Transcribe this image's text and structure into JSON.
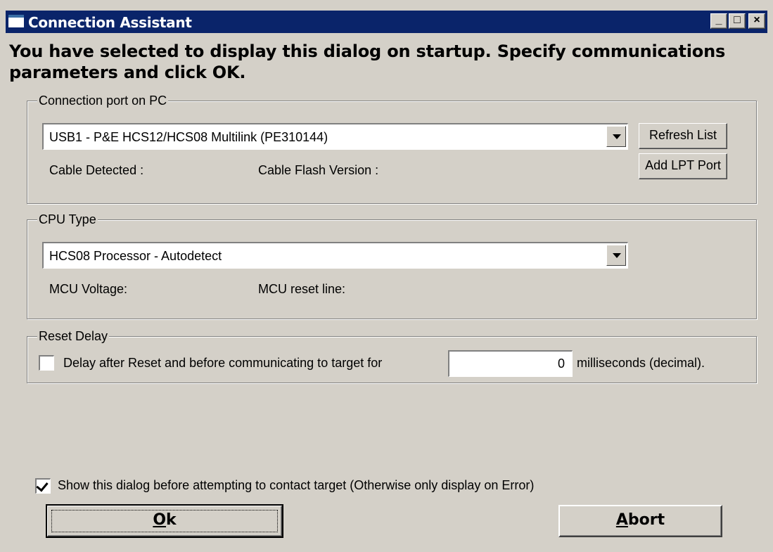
{
  "window": {
    "title": "Connection Assistant",
    "controls": {
      "minimize": "_",
      "maximize": "□",
      "close": "×"
    }
  },
  "heading": "You have selected to display this dialog on startup. Specify communications parameters and click OK.",
  "connection": {
    "group_label": "Connection port on PC",
    "port_value": "USB1 - P&E HCS12/HCS08 Multilink (PE310144)",
    "cable_detected_label": "Cable Detected :",
    "cable_flash_label": "Cable Flash Version :",
    "refresh_label": "Refresh List",
    "add_lpt_label": "Add LPT Port"
  },
  "cpu": {
    "group_label": "CPU Type",
    "cpu_value": "HCS08 Processor - Autodetect",
    "voltage_label": "MCU Voltage:",
    "reset_line_label": "MCU reset line:"
  },
  "reset": {
    "group_label": "Reset Delay",
    "checkbox_label": "Delay after Reset and before communicating to target for",
    "checked": false,
    "delay_value": "0",
    "unit_label": "milliseconds (decimal)."
  },
  "show_dialog": {
    "label": "Show this dialog before attempting to contact target (Otherwise only display on Error)",
    "checked": true
  },
  "buttons": {
    "ok_accel": "O",
    "ok_rest": "k",
    "abort_accel": "A",
    "abort_rest": "bort"
  }
}
